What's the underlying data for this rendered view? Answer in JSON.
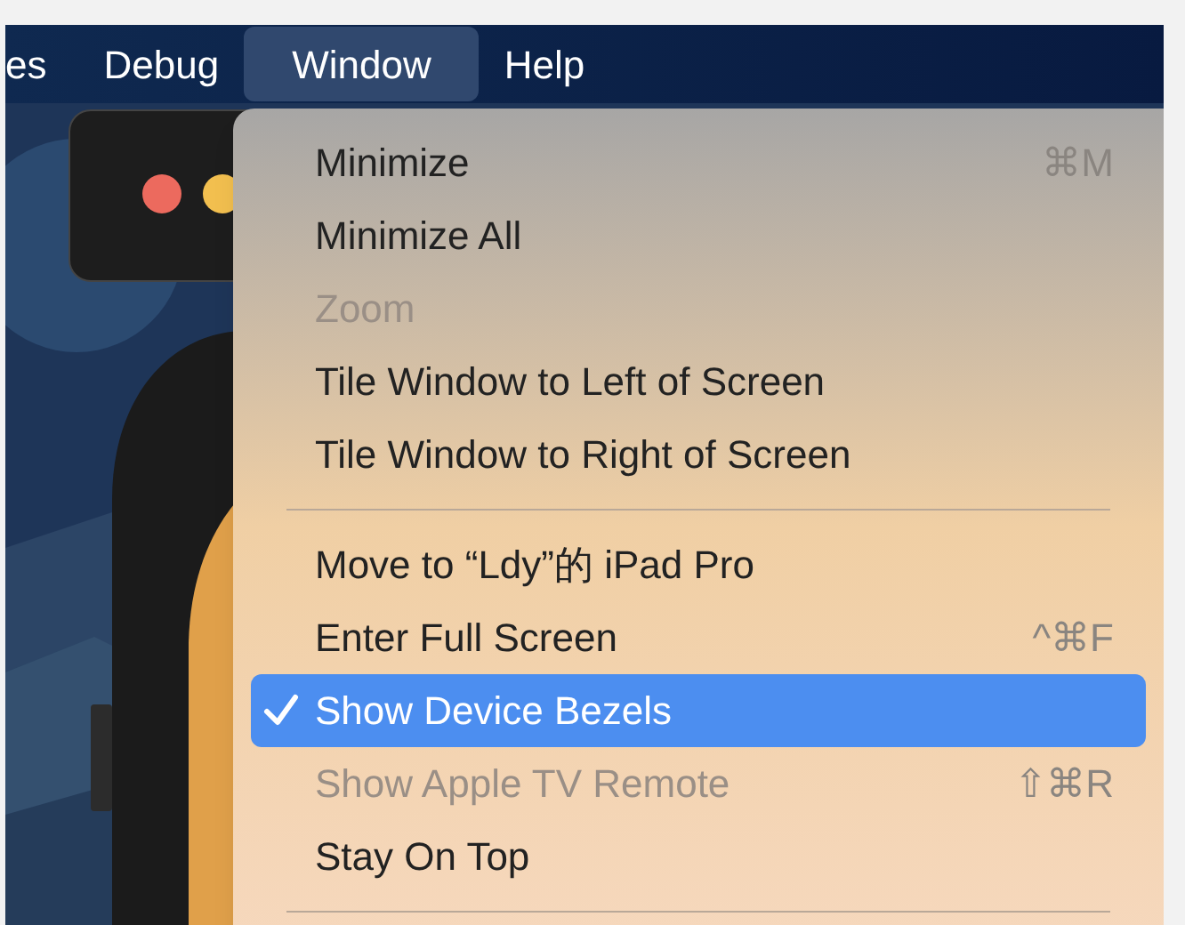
{
  "menu_bar": [
    {
      "label": "es",
      "selected": false
    },
    {
      "label": "Debug",
      "selected": false
    },
    {
      "label": "Window",
      "selected": true
    },
    {
      "label": "Help",
      "selected": false
    }
  ],
  "window_menu": {
    "items": [
      {
        "kind": "item",
        "label": "Minimize",
        "shortcut": "⌘M",
        "disabled": false,
        "checked": false,
        "selected": false
      },
      {
        "kind": "item",
        "label": "Minimize All",
        "disabled": false,
        "checked": false,
        "selected": false
      },
      {
        "kind": "item",
        "label": "Zoom",
        "disabled": true,
        "checked": false,
        "selected": false
      },
      {
        "kind": "item",
        "label": "Tile Window to Left of Screen",
        "disabled": false,
        "checked": false,
        "selected": false
      },
      {
        "kind": "item",
        "label": "Tile Window to Right of Screen",
        "disabled": false,
        "checked": false,
        "selected": false
      },
      {
        "kind": "separator"
      },
      {
        "kind": "item",
        "label": "Move to “Ldy”的 iPad Pro",
        "disabled": false,
        "checked": false,
        "selected": false
      },
      {
        "kind": "item",
        "label": "Enter Full Screen",
        "shortcut": "^⌘F",
        "disabled": false,
        "checked": false,
        "selected": false
      },
      {
        "kind": "item",
        "label": "Show Device Bezels",
        "disabled": false,
        "checked": true,
        "selected": true
      },
      {
        "kind": "item",
        "label": "Show Apple TV Remote",
        "shortcut": "⇧⌘R",
        "disabled": true,
        "checked": false,
        "selected": false
      },
      {
        "kind": "item",
        "label": "Stay On Top",
        "disabled": false,
        "checked": false,
        "selected": false
      },
      {
        "kind": "separator"
      }
    ]
  }
}
